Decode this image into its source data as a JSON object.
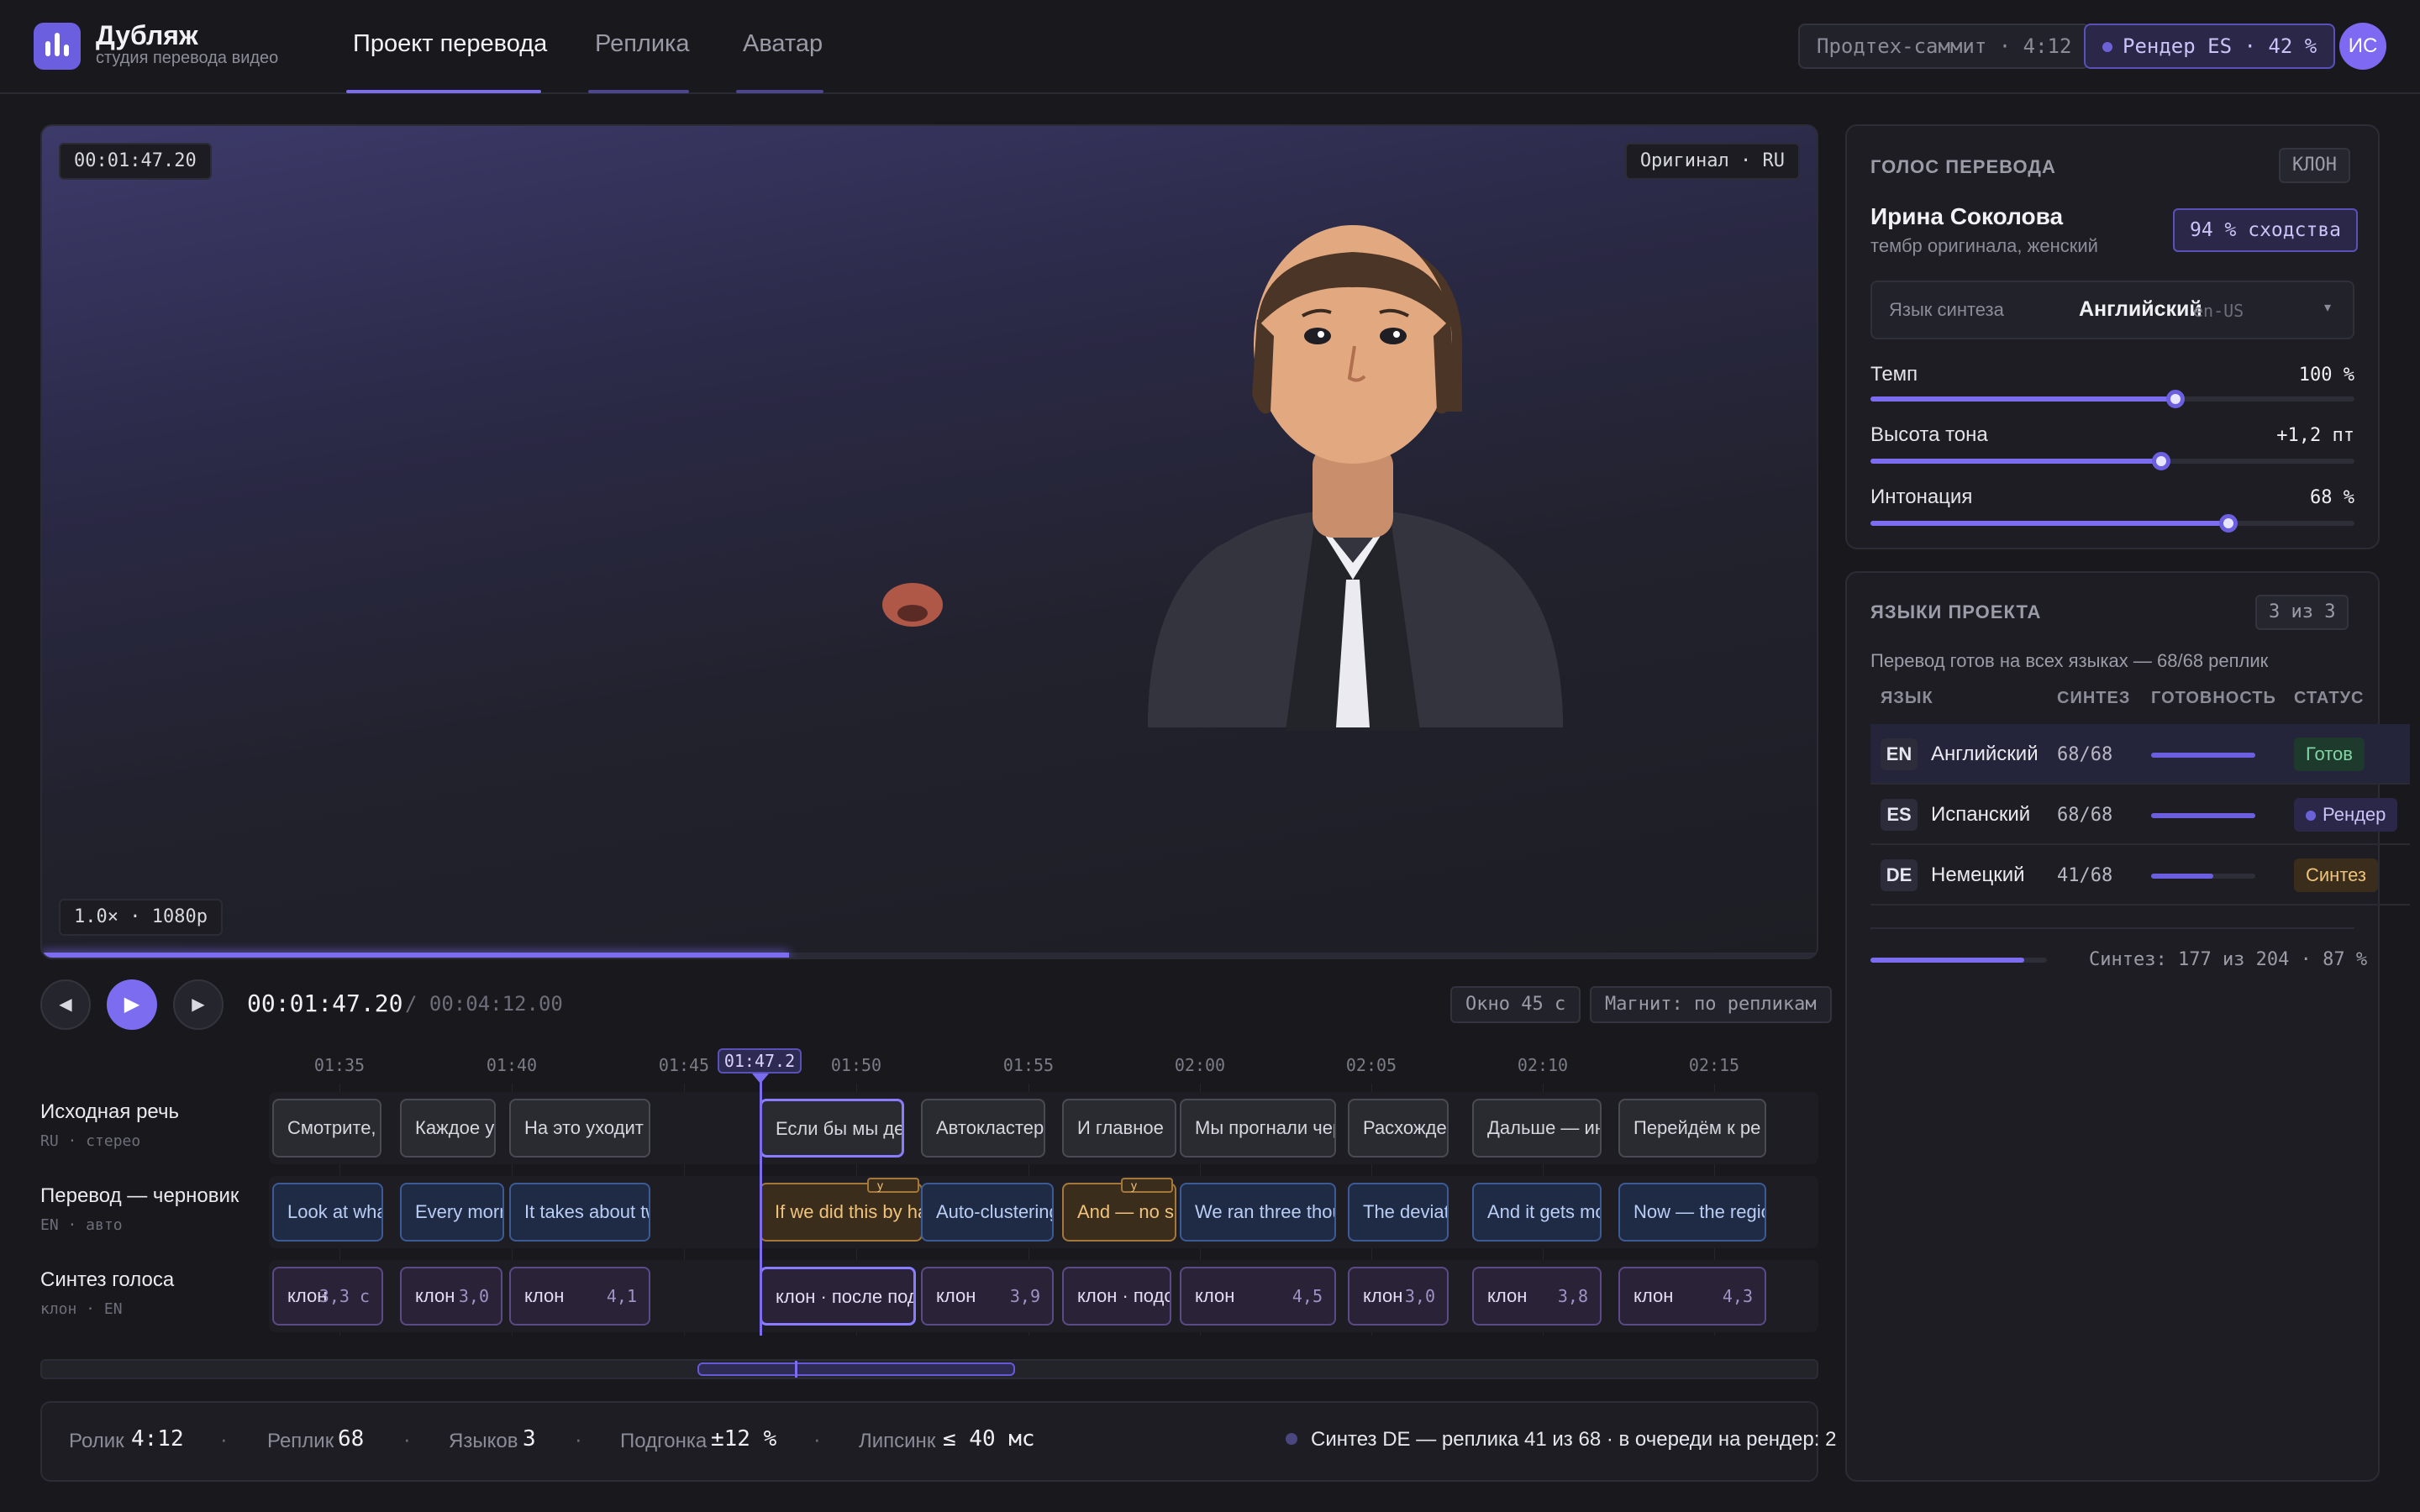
{
  "app": {
    "name": "Дубляж",
    "subtitle": "студия перевода видео"
  },
  "nav": {
    "tabs": [
      "Проект перевода",
      "Реплика",
      "Аватар"
    ]
  },
  "header": {
    "project_chip": "Продтех-саммит · 4:12",
    "render_chip": "Рендер ES · 42 %",
    "render_progress": 42,
    "user_initials": "ИС"
  },
  "video": {
    "timecode": "00:01:47.20",
    "source_badge": "Оригинал · RU",
    "quality_badge": "1.0× · 1080p",
    "progress_fraction": 0.42
  },
  "transport": {
    "current": "00:01:47.20",
    "total": "/ 00:04:12.00",
    "window_chip": "Окно 45 с",
    "magnet_chip": "Магнит: по репликам",
    "prev_icon": "skip-back-icon",
    "play_icon": "play-icon",
    "next_icon": "skip-forward-icon"
  },
  "timeline": {
    "ticks": [
      "01:35",
      "01:40",
      "01:45",
      "01:50",
      "01:55",
      "02:00",
      "02:05",
      "02:10",
      "02:15"
    ],
    "playhead_label": "01:47.2",
    "tracks": [
      {
        "label": "Исходная речь",
        "sub": "RU · стерео"
      },
      {
        "label": "Перевод — черновик",
        "sub": "EN · авто"
      },
      {
        "label": "Синтез голоса",
        "sub": "клон · EN"
      }
    ],
    "source_clips": [
      "Смотрите, ч",
      "Каждое у",
      "На это уходит о",
      "Если бы мы дел",
      "Автокластери",
      "И главное",
      "Мы прогнали чер",
      "Расхожден",
      "Дальше — инт",
      "Перейдём к ре"
    ],
    "translation_clips": [
      "Look at what",
      "Every morni",
      "It takes about tw",
      "If we did this by ha",
      "Auto-clustering",
      "And — no su",
      "We ran three thous",
      "The deviati",
      "And it gets mor",
      "Now — the regio"
    ],
    "warn_tag": "у",
    "synth_clips": [
      {
        "label": "клон",
        "dur": "3,3 с"
      },
      {
        "label": "клон",
        "dur": "3,0"
      },
      {
        "label": "клон",
        "dur": "4,1"
      },
      {
        "label": "клон · после подгон",
        "dur": ""
      },
      {
        "label": "клон",
        "dur": "3,9"
      },
      {
        "label": "клон · подог",
        "dur": ""
      },
      {
        "label": "клон",
        "dur": "4,5"
      },
      {
        "label": "клон",
        "dur": "3,0"
      },
      {
        "label": "клон",
        "dur": "3,8"
      },
      {
        "label": "клон",
        "dur": "4,3"
      }
    ]
  },
  "footer": {
    "items": [
      {
        "label": "Ролик",
        "value": "4:12"
      },
      {
        "label": "Реплик",
        "value": "68"
      },
      {
        "label": "Языков",
        "value": "3"
      },
      {
        "label": "Подгонка",
        "value": "±12 %"
      },
      {
        "label": "Липсинк",
        "value": "≤ 40 мс"
      }
    ],
    "sep": "·",
    "status": "Синтез DE — реплика 41 из 68 · в очереди на рендер: 2"
  },
  "voice": {
    "title": "ГОЛОС ПЕРЕВОДА",
    "badge": "КЛОН",
    "name": "Ирина Соколова",
    "desc": "тембр оригинала, женский",
    "similarity": "94 % сходства",
    "lang_label": "Язык синтеза",
    "lang_value": "Английский",
    "lang_code": "en-US",
    "sliders": [
      {
        "label": "Темп",
        "value": "100 %",
        "level": 0.63
      },
      {
        "label": "Высота тона",
        "value": "+1,2 пт",
        "level": 0.6
      },
      {
        "label": "Интонация",
        "value": "68 %",
        "level": 0.74
      }
    ]
  },
  "languages": {
    "title": "ЯЗЫКИ ПРОЕКТА",
    "badge": "3 из 3",
    "summary": "Перевод готов на всех языках — 68/68 реплик",
    "headers": [
      "ЯЗЫК",
      "СИНТЕЗ",
      "ГОТОВНОСТЬ",
      "СТАТУС"
    ],
    "rows": [
      {
        "code": "EN",
        "name": "Английский",
        "synth": "68/68",
        "ready": 1.0,
        "status": "Готов",
        "color": "#4caf7a"
      },
      {
        "code": "ES",
        "name": "Испанский",
        "synth": "68/68",
        "ready": 1.0,
        "status": "Рендер",
        "color": "#7b6cf0"
      },
      {
        "code": "DE",
        "name": "Немецкий",
        "synth": "41/68",
        "ready": 0.6,
        "status": "Синтез",
        "color": "#e0a84c"
      }
    ],
    "total": "Синтез: 177 из 204 · 87 %",
    "total_fraction": 0.87
  }
}
